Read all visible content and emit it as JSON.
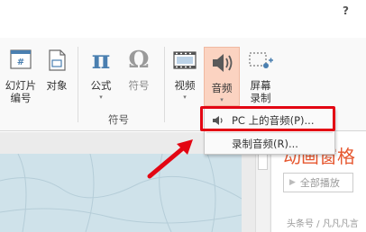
{
  "help": {
    "label": "?"
  },
  "ribbon": {
    "buttons": [
      {
        "id": "slide-number",
        "label": "幻灯片\n编号",
        "icon": "slide-number-icon"
      },
      {
        "id": "object",
        "label": "对象",
        "icon": "object-icon"
      },
      {
        "id": "equation",
        "label": "公式",
        "icon": "pi-icon"
      },
      {
        "id": "symbol",
        "label": "符号",
        "icon": "omega-icon"
      },
      {
        "id": "video",
        "label": "视频",
        "icon": "film-icon"
      },
      {
        "id": "audio",
        "label": "音频",
        "icon": "speaker-icon"
      },
      {
        "id": "screen-recording",
        "label": "屏幕\n录制",
        "icon": "screen-recording-icon"
      }
    ],
    "group_label": "符号"
  },
  "dropdown": {
    "items": [
      {
        "label": "PC 上的音频(P)...",
        "icon": "speaker-small-icon"
      },
      {
        "label": "录制音频(R)..."
      }
    ]
  },
  "pane": {
    "title": "动画窗格",
    "play_label": "全部播放"
  },
  "watermark": "头条号 / 凡凡凡言",
  "colors": {
    "accent": "#e6572f",
    "highlight": "#e30613",
    "audio_button_bg": "#fbd3c1",
    "icon_blue": "#4a7fb0"
  }
}
